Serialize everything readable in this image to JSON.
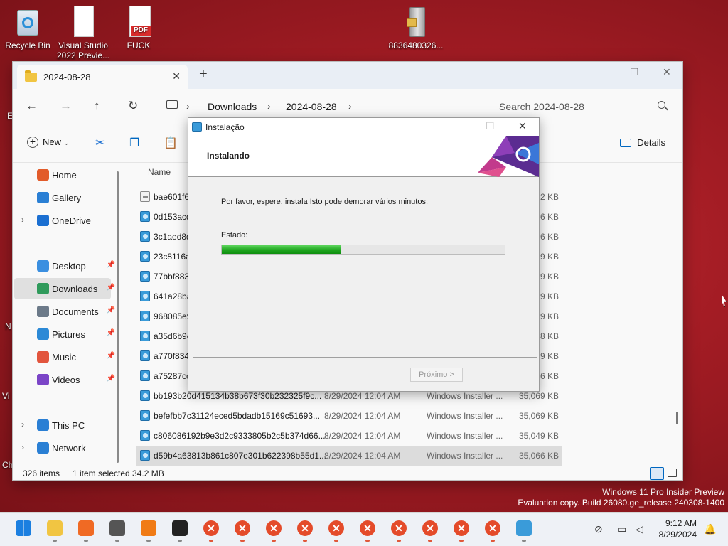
{
  "desktop": {
    "icons": [
      {
        "label": "Recycle Bin",
        "icon": "recycle-bin-icon"
      },
      {
        "label": "Visual Studio 2022 Previe...",
        "icon": "document-icon"
      },
      {
        "label": "FUCK",
        "icon": "pdf-icon",
        "badge": "PDF"
      },
      {
        "label": "8836480326...",
        "icon": "archive-icon"
      }
    ],
    "edge_texts": [
      "E",
      "N",
      "Vi",
      "Ch"
    ],
    "watermark": {
      "line1": "Windows 11 Pro Insider Preview",
      "line2": "Evaluation copy. Build 26080.ge_release.240308-1400"
    }
  },
  "explorer": {
    "tab_title": "2024-08-28",
    "breadcrumb": [
      "Downloads",
      "2024-08-28"
    ],
    "search_placeholder": "Search 2024-08-28",
    "toolbar": {
      "new_label": "New",
      "details_label": "Details"
    },
    "sidebar": [
      {
        "label": "Home",
        "icon": "home-icon",
        "color": "#e25b2a"
      },
      {
        "label": "Gallery",
        "icon": "gallery-icon",
        "color": "#2a7fd4"
      },
      {
        "label": "OneDrive",
        "icon": "onedrive-icon",
        "color": "#1b6fd1"
      },
      {
        "label": "Desktop",
        "icon": "desktop-icon",
        "color": "#3b8fe0"
      },
      {
        "label": "Downloads",
        "icon": "downloads-icon",
        "color": "#2f9a5b"
      },
      {
        "label": "Documents",
        "icon": "documents-icon",
        "color": "#6c7a89"
      },
      {
        "label": "Pictures",
        "icon": "pictures-icon",
        "color": "#2c89d6"
      },
      {
        "label": "Music",
        "icon": "music-icon",
        "color": "#e2553d"
      },
      {
        "label": "Videos",
        "icon": "videos-icon",
        "color": "#7b45c7"
      },
      {
        "label": "This PC",
        "icon": "this-pc-icon",
        "color": "#2a7fd4"
      },
      {
        "label": "Network",
        "icon": "network-icon",
        "color": "#2a7fd4"
      }
    ],
    "column_name": "Name",
    "files": [
      {
        "name": "bae601f67",
        "date": "",
        "type": "",
        "size": "2 KB",
        "kind": "txt"
      },
      {
        "name": "0d153acd",
        "date": "",
        "type": "",
        "size": "06 KB"
      },
      {
        "name": "3c1aed8d",
        "date": "",
        "type": "",
        "size": "06 KB"
      },
      {
        "name": "23c8116a",
        "date": "",
        "type": "",
        "size": "59 KB"
      },
      {
        "name": "77bbf883",
        "date": "",
        "type": "",
        "size": "59 KB"
      },
      {
        "name": "641a28ba",
        "date": "",
        "type": "",
        "size": "39 KB"
      },
      {
        "name": "968085e9",
        "date": "",
        "type": "",
        "size": "39 KB"
      },
      {
        "name": "a35d6b9e",
        "date": "",
        "type": "",
        "size": "58 KB"
      },
      {
        "name": "a770f8342",
        "date": "",
        "type": "",
        "size": "59 KB"
      },
      {
        "name": "a75287cc",
        "date": "",
        "type": "",
        "size": "06 KB"
      },
      {
        "name": "bb193b20d415134b38b673f30b232325f9c...",
        "date": "8/29/2024 12:04 AM",
        "type": "Windows Installer ...",
        "size": "35,069 KB"
      },
      {
        "name": "befefbb7c31124eced5bdadb15169c51693...",
        "date": "8/29/2024 12:04 AM",
        "type": "Windows Installer ...",
        "size": "35,069 KB"
      },
      {
        "name": "c806086192b9e3d2c9333805b2c5b374d66...",
        "date": "8/29/2024 12:04 AM",
        "type": "Windows Installer ...",
        "size": "35,049 KB"
      },
      {
        "name": "d59b4a63813b861c807e301b622398b55d1...",
        "date": "8/29/2024 12:04 AM",
        "type": "Windows Installer ...",
        "size": "35,066 KB",
        "selected": true
      }
    ],
    "status": {
      "count": "326 items",
      "selection": "1 item selected  34.2 MB"
    }
  },
  "dialog": {
    "title": "Instalação",
    "heading": "Instalando",
    "message": "Por favor, espere.  instala  Isto pode demorar vários minutos.",
    "status_label": "Estado:",
    "progress": 0.42,
    "next_label": "Próximo >"
  },
  "taskbar": {
    "apps": [
      "start-icon",
      "file-explorer-icon",
      "firefox-icon",
      "camera-icon",
      "search-tool-icon",
      "capcut-icon",
      "error-icon",
      "error-icon",
      "error-icon",
      "error-icon",
      "error-icon",
      "error-icon",
      "error-icon",
      "error-icon",
      "error-icon",
      "error-icon",
      "installer-icon"
    ],
    "time": "9:12 AM",
    "date": "8/29/2024"
  }
}
